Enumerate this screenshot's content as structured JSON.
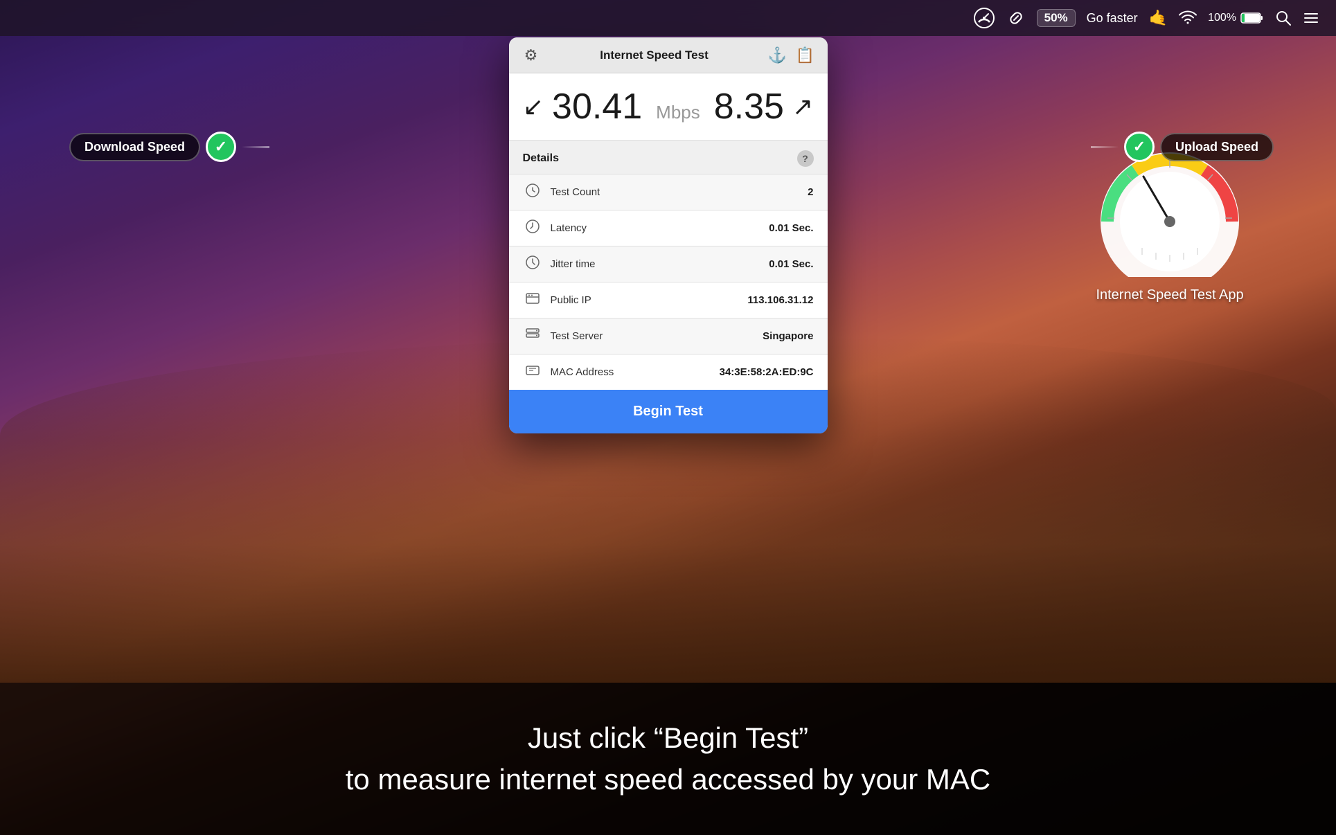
{
  "desktop": {
    "background": "macOS Mojave desert"
  },
  "menubar": {
    "speedometer_icon": "⏱",
    "link_icon": "🔗",
    "battery_label": "50%",
    "go_faster_label": "Go faster",
    "hand_icon": "🤙",
    "wifi_icon": "wifi",
    "battery_percent": "100%",
    "battery_icon": "battery",
    "search_icon": "search",
    "list_icon": "list"
  },
  "window": {
    "title": "Internet Speed Test",
    "gear_icon": "⚙",
    "anchor_icon": "⚓",
    "clipboard_icon": "📋",
    "download_speed": "30.41",
    "download_arrow": "⬇",
    "speed_unit": "Mbps",
    "upload_speed": "8.35",
    "upload_arrow": "⬆",
    "details_title": "Details",
    "help_icon": "?",
    "rows": [
      {
        "icon": "⏱",
        "label": "Test Count",
        "value": "2"
      },
      {
        "icon": "⏱",
        "label": "Latency",
        "value": "0.01 Sec."
      },
      {
        "icon": "⏱",
        "label": "Jitter time",
        "value": "0.01 Sec."
      },
      {
        "icon": "🖥",
        "label": "Public IP",
        "value": "113.106.31.12"
      },
      {
        "icon": "🖥",
        "label": "Test Server",
        "value": "Singapore"
      },
      {
        "icon": "🖥",
        "label": "MAC Address",
        "value": "34:3E:58:2A:ED:9C"
      }
    ],
    "begin_test_label": "Begin Test"
  },
  "download_label": {
    "text": "Download Speed",
    "check": "✓"
  },
  "upload_label": {
    "text": "Upload Speed",
    "check": "✓"
  },
  "speedometer_app": {
    "label": "Internet Speed Test App"
  },
  "caption": {
    "line1": "Just click “Begin Test”",
    "line2": "to measure internet speed accessed by your MAC"
  }
}
